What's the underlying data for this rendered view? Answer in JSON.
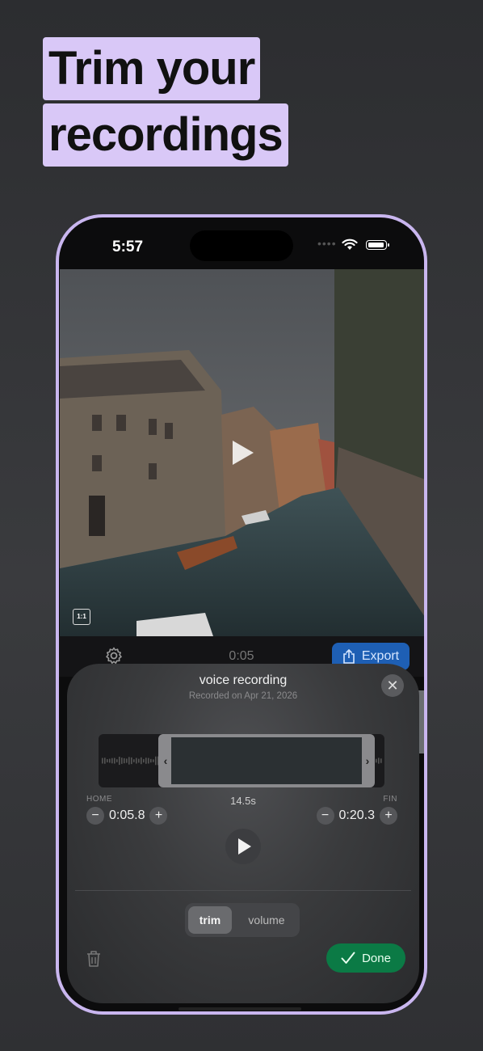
{
  "headline": {
    "line1": "Trim your",
    "line2": "recordings",
    "highlight_color": "#d9c8f7"
  },
  "status_bar": {
    "time": "5:57",
    "icons": [
      "cellular-dots-icon",
      "wifi-icon",
      "battery-icon"
    ]
  },
  "video": {
    "aspect_badge": "1:1",
    "scene": "Venice canal with boats"
  },
  "toolbar": {
    "timecode": "0:05",
    "export_label": "Export",
    "export_color": "#1e5fb4"
  },
  "sheet": {
    "title": "voice recording",
    "subtitle": "Recorded on Apr 21, 2026",
    "start_label": "HOME",
    "duration": "14.5s",
    "end_label": "FIN",
    "start_value": "0:05.8",
    "end_value": "0:20.3",
    "minus": "−",
    "plus": "+",
    "tabs": [
      {
        "label": "trim",
        "active": true
      },
      {
        "label": "volume",
        "active": false
      }
    ],
    "done_label": "Done",
    "done_color": "#0b7a45",
    "close_glyph": "✕"
  }
}
